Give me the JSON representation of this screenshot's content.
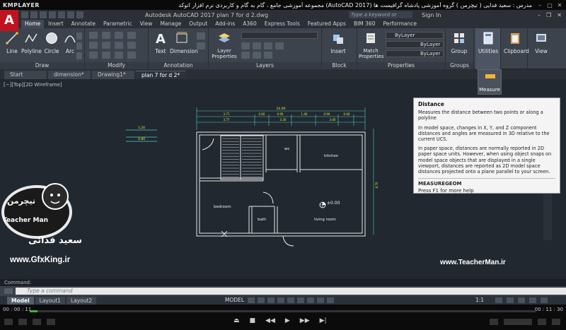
{
  "player": {
    "brand": "KMPLAYER",
    "title": "مجموعه آموزشی جامع ، گام به گام و کاربردی نرم افزار اتوکد (AutoCAD 2017) مدرس : سعید فدایی ( تیچرمن ) گروه آموزشی پادشاه گرافیست ها",
    "time_current": "00 : 00 : 11",
    "time_total": "00 : 11 : 30",
    "progress": 0.016
  },
  "acad": {
    "logo": "A",
    "app_title": "Autodesk AutoCAD 2017    plan 7 for d 2.dwg",
    "search_placeholder": "Type a keyword or phrase",
    "signin": "Sign In",
    "tabs": [
      "Home",
      "Insert",
      "Annotate",
      "Parametric",
      "View",
      "Manage",
      "Output",
      "Add-ins",
      "A360",
      "Express Tools",
      "Featured Apps",
      "BIM 360",
      "Performance"
    ],
    "active_tab": "Home"
  },
  "ribbon": {
    "groups": [
      "Draw",
      "Modify",
      "Annotation",
      "Layers",
      "Block",
      "Properties",
      "Groups"
    ],
    "tools": {
      "line": "Line",
      "polyline": "Polyline",
      "circle": "Circle",
      "arc": "Arc",
      "text": "Text",
      "dimension": "Dimension",
      "layer_properties": "Layer\nProperties",
      "insert": "Insert",
      "match_properties": "Match\nProperties",
      "group": "Group",
      "utilities": "Utilities",
      "clipboard": "Clipboard",
      "view": "View"
    },
    "bylayer_1": "ByLayer",
    "bylayer_2": "ByLayer",
    "bylayer_3": "ByLayer"
  },
  "file_tabs": [
    "Start",
    "dimension*",
    "Drawing1*",
    "plan 7 for d 2*"
  ],
  "active_file_tab": "plan 7 for d 2*",
  "viewport": {
    "label": "[−][Top][2D Wireframe]",
    "rooms": {
      "wc": "wc",
      "kitchen": "kitchen",
      "bedroom": "bedroom",
      "bath": "bath",
      "living": "living room",
      "elev": "±0.00"
    },
    "dim_total": "10.90",
    "dims_top": [
      "3.77",
      "0.60",
      "0.90",
      "1.46",
      "0.90",
      "0.60"
    ],
    "dims_top2": [
      "3.77",
      "3.30",
      "3.00"
    ],
    "dim_side": "8.70",
    "legend_dims": [
      "1.20",
      "0.80"
    ]
  },
  "measure": {
    "label": "Measure"
  },
  "tooltip": {
    "title": "Distance",
    "summary": "Measures the distance between two points or along a polyline",
    "p1": "In model space, changes in X, Y, and Z component distances and angles are measured in 3D relative to the current UCS.",
    "p2": "In paper space, distances are normally reported in 2D paper space units. However, when using object snaps on model space objects that are displayed in a single viewport, distances are reported as 2D model space distances projected onto a plane parallel to your screen.",
    "command": "MEASUREGEOM",
    "help": "Press F1 for more help"
  },
  "overlay": {
    "left_name": "سعید فدائی",
    "left_url": "www.GfxKing.ir",
    "logo_text_1": "تیچرمن",
    "logo_text_2": "Teacher Man",
    "right_url": "www.TeacherMan.ir"
  },
  "command": {
    "history": "Command:",
    "placeholder": "Type a command"
  },
  "layout_tabs": [
    "Model",
    "Layout1",
    "Layout2"
  ],
  "status": {
    "model": "MODEL",
    "scale": "1:1"
  },
  "colors": {
    "canvas": "#212830",
    "accent": "#c1121f",
    "progress": "#3bb54a"
  }
}
